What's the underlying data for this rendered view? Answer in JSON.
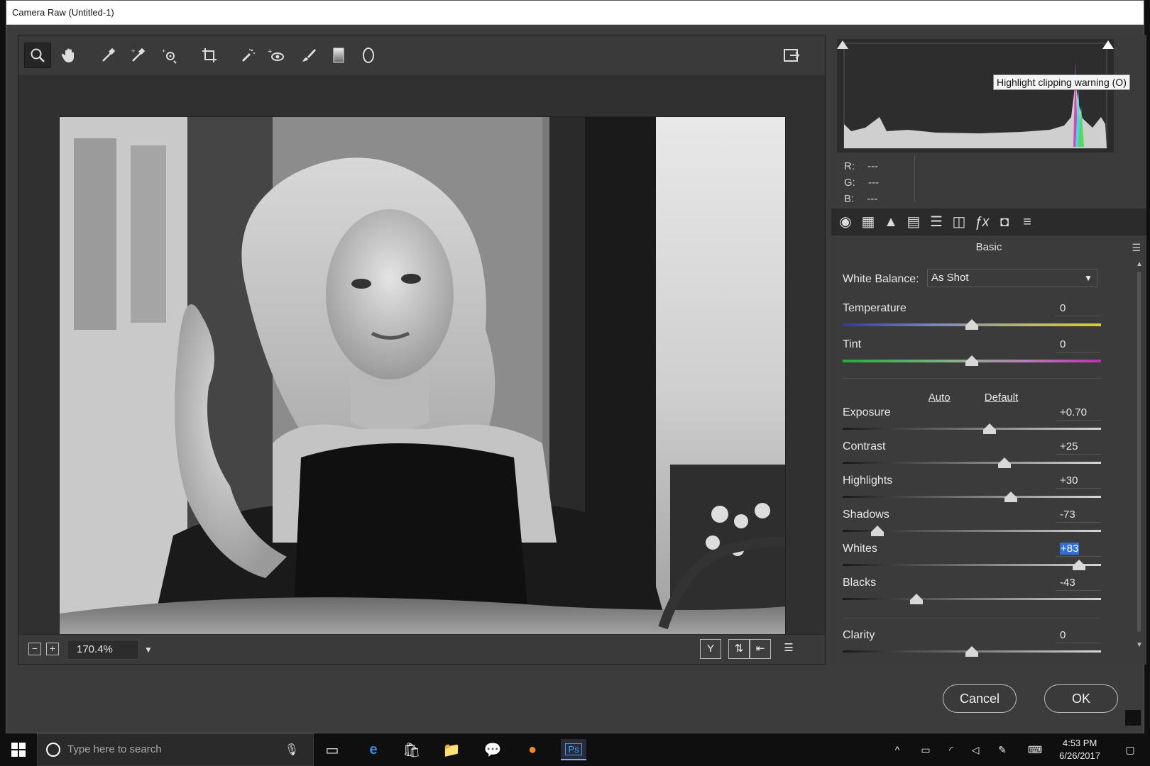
{
  "window": {
    "title": "Camera Raw (Untitled-1)"
  },
  "toolbar": {
    "tools": [
      "zoom-icon",
      "hand-icon",
      "white-balance-icon",
      "color-sampler-icon",
      "targeted-adjustment-icon",
      "crop-icon",
      "spot-removal-icon",
      "red-eye-icon",
      "adjustment-brush-icon",
      "graduated-filter-icon",
      "radial-filter-icon"
    ],
    "toggle_fullscreen_icon": "fullscreen-icon"
  },
  "zoom": {
    "value": "170.4%"
  },
  "histogram": {
    "tooltip": "Highlight clipping warning (O)",
    "r_label": "R:",
    "r_value": "---",
    "g_label": "G:",
    "g_value": "---",
    "b_label": "B:",
    "b_value": "---"
  },
  "panel": {
    "title": "Basic",
    "white_balance_label": "White Balance:",
    "white_balance_value": "As Shot",
    "auto": "Auto",
    "default": "Default",
    "sliders": [
      {
        "label": "Temperature",
        "value": "0",
        "position": 0.5
      },
      {
        "label": "Tint",
        "value": "0",
        "position": 0.5
      },
      {
        "label": "Exposure",
        "value": "+0.70",
        "position": 0.57
      },
      {
        "label": "Contrast",
        "value": "+25",
        "position": 0.625
      },
      {
        "label": "Highlights",
        "value": "+30",
        "position": 0.65
      },
      {
        "label": "Shadows",
        "value": "-73",
        "position": 0.135
      },
      {
        "label": "Whites",
        "value": "+83",
        "position": 0.915
      },
      {
        "label": "Blacks",
        "value": "-43",
        "position": 0.285
      },
      {
        "label": "Clarity",
        "value": "0",
        "position": 0.5
      }
    ]
  },
  "buttons": {
    "cancel": "Cancel",
    "ok": "OK"
  },
  "taskbar": {
    "search_placeholder": "Type here to search",
    "time": "4:53 PM",
    "date": "6/26/2017"
  }
}
